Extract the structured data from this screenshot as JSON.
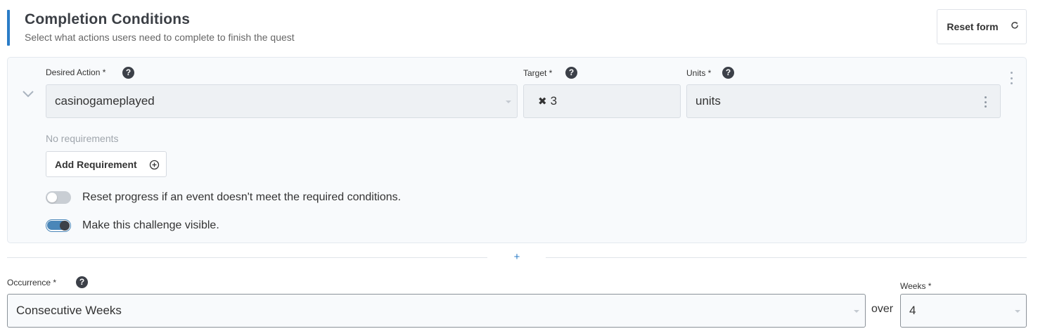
{
  "header": {
    "title": "Completion Conditions",
    "subtitle": "Select what actions users need to complete to finish the quest",
    "reset_label": "Reset form",
    "reset_icon": "refresh-icon"
  },
  "condition": {
    "action_label": "Desired Action *",
    "action_value": "casinogameplayed",
    "target_label": "Target *",
    "target_prefix": "✖",
    "target_value": "3",
    "units_label": "Units *",
    "units_value": "units",
    "no_requirements": "No requirements",
    "add_requirement_label": "Add Requirement",
    "reset_progress_label": "Reset progress if an event doesn't meet the required conditions.",
    "reset_progress_on": false,
    "visible_label": "Make this challenge visible.",
    "visible_on": true
  },
  "add_condition_symbol": "+",
  "occurrence": {
    "label": "Occurrence *",
    "value": "Consecutive Weeks",
    "over_label": "over",
    "weeks_label": "Weeks *",
    "weeks_value": "4"
  },
  "colors": {
    "accent": "#2a7cc7",
    "toggle_on": "#4a86b8",
    "help_icon": "#3c4048"
  }
}
